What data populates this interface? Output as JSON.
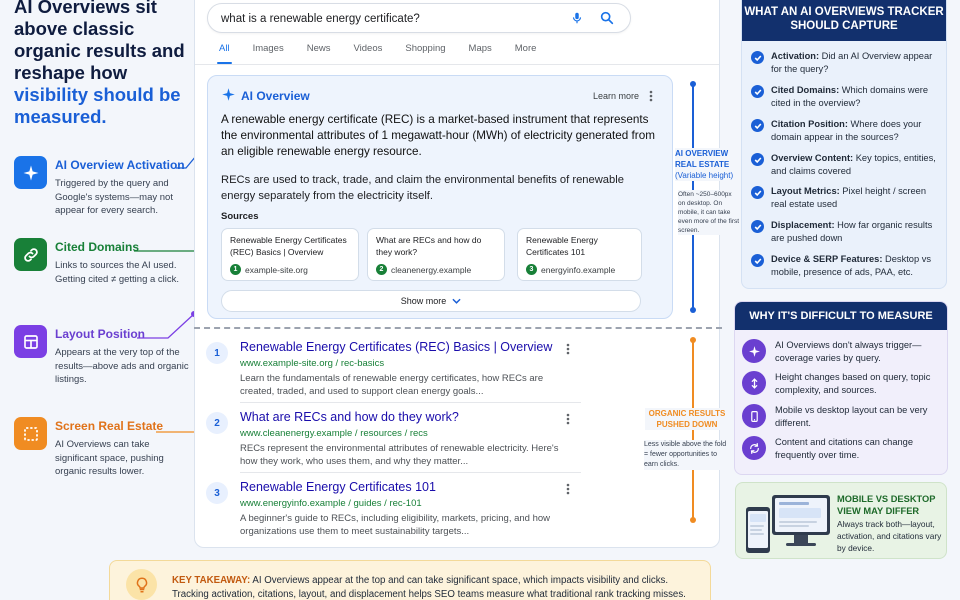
{
  "left": {
    "title_line1": "AI Overviews sit above classic organic results and reshape how ",
    "title_highlight": "visibility should be measured.",
    "features": [
      {
        "title": "AI Overview Activation",
        "desc": "Triggered by the query and Google's systems—may not appear for every search.",
        "color": "#1a73e8"
      },
      {
        "title": "Cited Domains",
        "desc": "Links to sources the AI used. Getting cited ≠ getting a click.",
        "color": "#188038"
      },
      {
        "title": "Layout Position",
        "desc": "Appears at the very top of the results—above ads and organic listings.",
        "color": "#7b3fe4"
      },
      {
        "title": "Screen Real Estate",
        "desc": "AI Overviews can take significant space, pushing organic results lower.",
        "color": "#f08c22"
      }
    ]
  },
  "serp": {
    "query": "what is a renewable energy certificate?",
    "tabs": [
      "All",
      "Images",
      "News",
      "Videos",
      "Shopping",
      "Maps",
      "More"
    ],
    "aio": {
      "title": "AI Overview",
      "learn_more": "Learn more",
      "p1": "A renewable energy certificate (REC) is a market-based instrument that represents the environmental attributes of 1 megawatt-hour (MWh) of electricity generated from an eligible renewable energy resource.",
      "p2": "RECs are used to track, trade, and claim the environmental benefits of renewable energy separately from the electricity itself.",
      "sources_heading": "Sources",
      "sources": [
        {
          "title": "Renewable Energy Certificates (REC) Basics | Overview",
          "num": "1",
          "domain": "example-site.org"
        },
        {
          "title": "What are RECs and how do they work?",
          "num": "2",
          "domain": "cleanenergy.example"
        },
        {
          "title": "Renewable Energy Certificates 101",
          "num": "3",
          "domain": "energyinfo.example"
        }
      ],
      "show_more": "Show more"
    },
    "results": [
      {
        "num": "1",
        "title": "Renewable Energy Certificates (REC) Basics | Overview",
        "url": "www.example-site.org / rec-basics",
        "desc": "Learn the fundamentals of renewable energy certificates, how RECs are created, traded, and used to support clean energy goals..."
      },
      {
        "num": "2",
        "title": "What are RECs and how do they work?",
        "url": "www.cleanenergy.example / resources / recs",
        "desc": "RECs represent the environmental attributes of renewable electricity. Here's how they work, who uses them, and why they matter..."
      },
      {
        "num": "3",
        "title": "Renewable Energy Certificates 101",
        "url": "www.energyinfo.example / guides / rec-101",
        "desc": "A beginner's guide to RECs, including eligibility, markets, pricing, and how organizations use them to meet sustainability targets..."
      }
    ]
  },
  "annotations": {
    "real_estate_label": "AI OVERVIEW REAL ESTATE",
    "real_estate_sub": "(Variable height)",
    "real_estate_note": "Often ~250–600px on desktop. On mobile, it can take even more of the first screen.",
    "organic_label": "ORGANIC RESULTS PUSHED DOWN",
    "organic_note": "Less visible above the fold = fewer opportunities to earn clicks."
  },
  "takeaway": {
    "label": "KEY TAKEAWAY:",
    "text": " AI Overviews appear at the top and can take significant space, which impacts visibility and clicks. Tracking activation, citations, layout, and displacement helps SEO teams measure what traditional rank tracking misses."
  },
  "tracker": {
    "heading": "WHAT AN AI OVERVIEWS TRACKER SHOULD CAPTURE",
    "items": [
      {
        "label": "Activation:",
        "text": " Did an AI Overview appear for the query?"
      },
      {
        "label": "Cited Domains:",
        "text": " Which domains were cited in the overview?"
      },
      {
        "label": "Citation Position:",
        "text": " Where does your domain appear in the sources?"
      },
      {
        "label": "Overview Content:",
        "text": " Key topics, entities, and claims covered"
      },
      {
        "label": "Layout Metrics:",
        "text": " Pixel height / screen real estate used"
      },
      {
        "label": "Displacement:",
        "text": " How far organic results are pushed down"
      },
      {
        "label": "Device & SERP Features:",
        "text": " Desktop vs mobile, presence of ads, PAA, etc."
      }
    ]
  },
  "difficult": {
    "heading": "WHY IT'S DIFFICULT TO MEASURE",
    "items": [
      "AI Overviews don't always trigger—coverage varies by query.",
      "Height changes based on query, topic complexity, and sources.",
      "Mobile vs desktop layout can be very different.",
      "Content and citations can change frequently over time."
    ]
  },
  "device": {
    "heading": "MOBILE VS DESKTOP VIEW MAY DIFFER",
    "text": "Always track both—layout, activation, and citations vary by device."
  }
}
